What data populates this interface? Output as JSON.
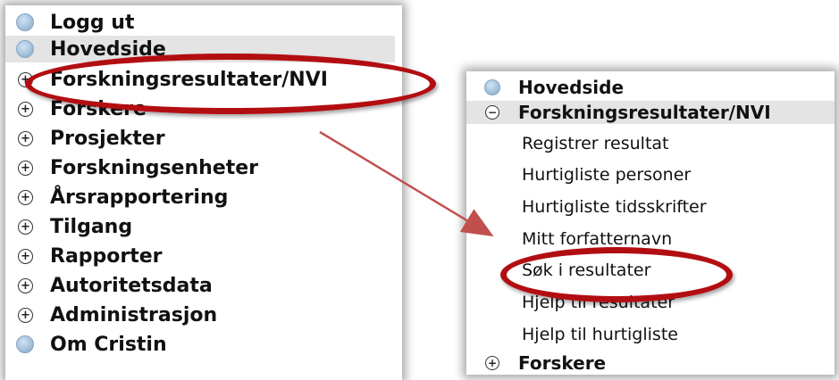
{
  "left_menu": {
    "items": [
      {
        "label": "Logg ut",
        "icon": "circle-bullet-icon"
      },
      {
        "label": "Hovedside",
        "icon": "circle-bullet-icon"
      },
      {
        "label": "Forskningsresultater/NVI",
        "icon": "expand-plus-icon"
      },
      {
        "label": "Forskere",
        "icon": "expand-plus-icon"
      },
      {
        "label": "Prosjekter",
        "icon": "expand-plus-icon"
      },
      {
        "label": "Forskningsenheter",
        "icon": "expand-plus-icon"
      },
      {
        "label": "Årsrapportering",
        "icon": "expand-plus-icon"
      },
      {
        "label": "Tilgang",
        "icon": "expand-plus-icon"
      },
      {
        "label": "Rapporter",
        "icon": "expand-plus-icon"
      },
      {
        "label": "Autoritetsdata",
        "icon": "expand-plus-icon"
      },
      {
        "label": "Administrasjon",
        "icon": "expand-plus-icon"
      },
      {
        "label": "Om Cristin",
        "icon": "circle-bullet-icon"
      }
    ],
    "plus_glyph": "+"
  },
  "right_menu": {
    "hovedside": "Hovedside",
    "expanded_section": "Forskningsresultater/NVI",
    "minus_glyph": "−",
    "plus_glyph": "+",
    "sub_items": [
      "Registrer resultat",
      "Hurtigliste personer",
      "Hurtigliste tidsskrifter",
      "Mitt forfatternavn",
      "Søk i resultater",
      "Hjelp til resultater",
      "Hjelp til hurtigliste"
    ],
    "forskere": "Forskere"
  },
  "colors": {
    "highlight_ellipse": "#b20e12",
    "arrow": "#c0504d",
    "row_highlight": "#e4e4e4"
  }
}
